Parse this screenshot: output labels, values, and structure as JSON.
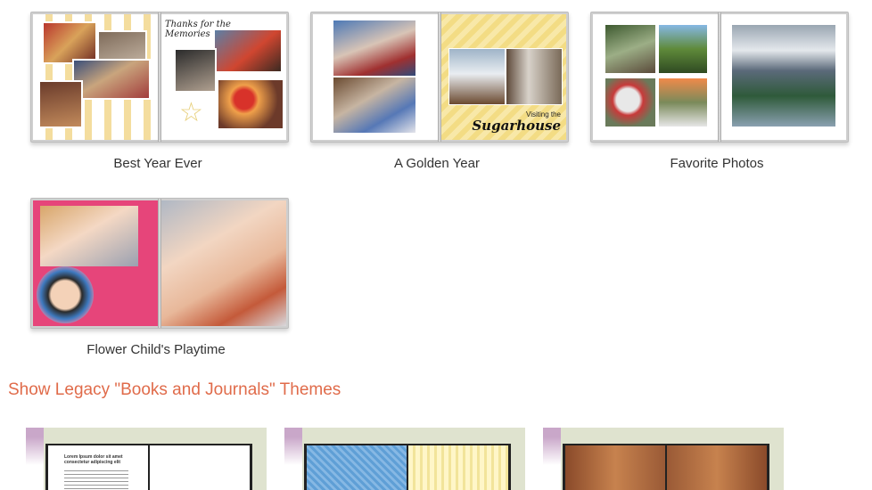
{
  "themes": [
    {
      "title": "Best Year Ever",
      "cover_script": "Thanks for the Memories"
    },
    {
      "title": "A Golden Year",
      "cover_script_small": "Visiting the",
      "cover_script_big": "Sugarhouse"
    },
    {
      "title": "Favorite Photos"
    },
    {
      "title": "Flower Child's Playtime"
    }
  ],
  "legacy_link": "Show Legacy \"Books and Journals\" Themes",
  "legacy_headline": "Lorem Ipsum dolor sit amet consectetur adipiscing elit",
  "colors": {
    "link": "#e06b4a",
    "caption": "#333333",
    "gold": "#f1d87a",
    "pink": "#e6457a"
  }
}
